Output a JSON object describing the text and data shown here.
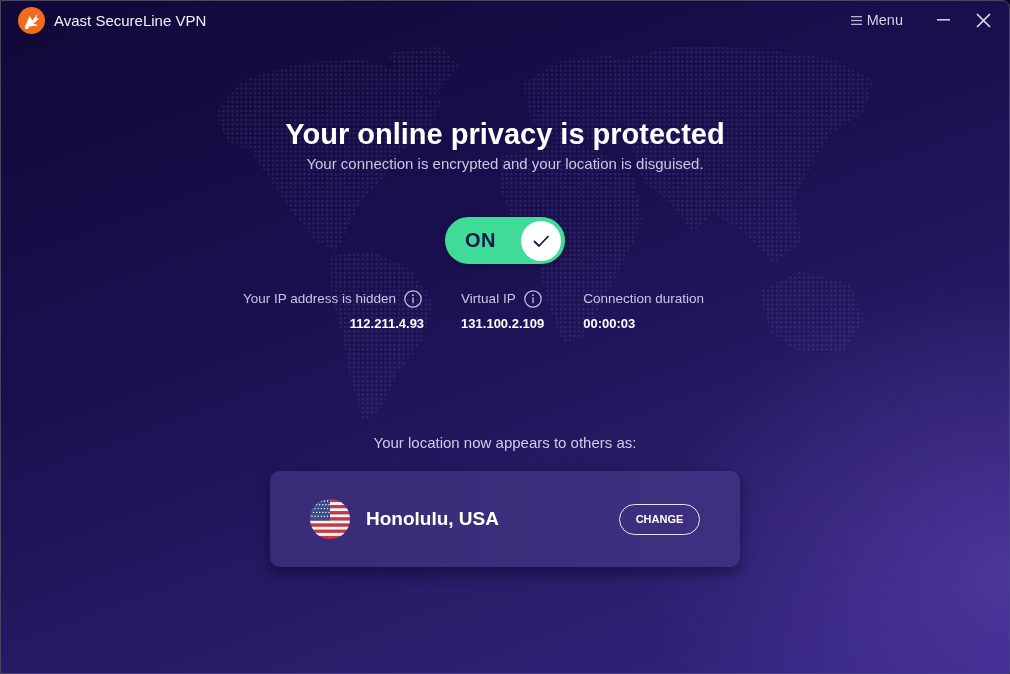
{
  "window": {
    "title": "Avast SecureLine VPN",
    "menu_label": "Menu"
  },
  "status": {
    "headline": "Your online privacy is protected",
    "subtitle": "Your connection is encrypted and your location is disguised."
  },
  "vpn_toggle": {
    "label": "ON",
    "on": true
  },
  "connection_info": [
    {
      "label": "Your IP address is hidden",
      "value": "112.211.4.93",
      "info_icon": true
    },
    {
      "label": "Virtual IP",
      "value": "131.100.2.109",
      "info_icon": true
    },
    {
      "label": "Connection duration",
      "value": "00:00:03",
      "info_icon": false
    }
  ],
  "location": {
    "prompt": "Your location now appears to others as:",
    "city": "Honolulu, USA",
    "button": "CHANGE"
  }
}
